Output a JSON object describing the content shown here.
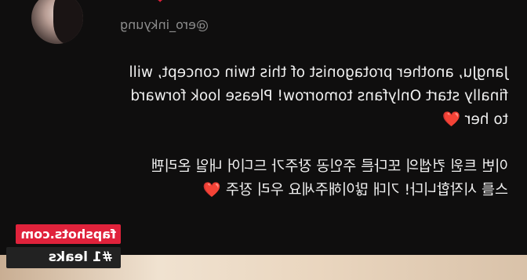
{
  "profile": {
    "handle": "@ero_inkyung",
    "avatar": "avatar"
  },
  "post": {
    "english": [
      "JangJu, another protagonist of this twin concept, will",
      "finally start Onlyfans tomorrow! Please look forward",
      "to her"
    ],
    "korean": [
      "이번 트윈 컨셉의 또다른 주인공 장주가 드디어 내일 온리팬",
      "스를 시작합니다! 기대 많이해주세요 우리 장주"
    ],
    "heart_color": "#e01d34"
  },
  "watermark": {
    "site": "fapshots.com",
    "tagline": "#1 leaks"
  }
}
